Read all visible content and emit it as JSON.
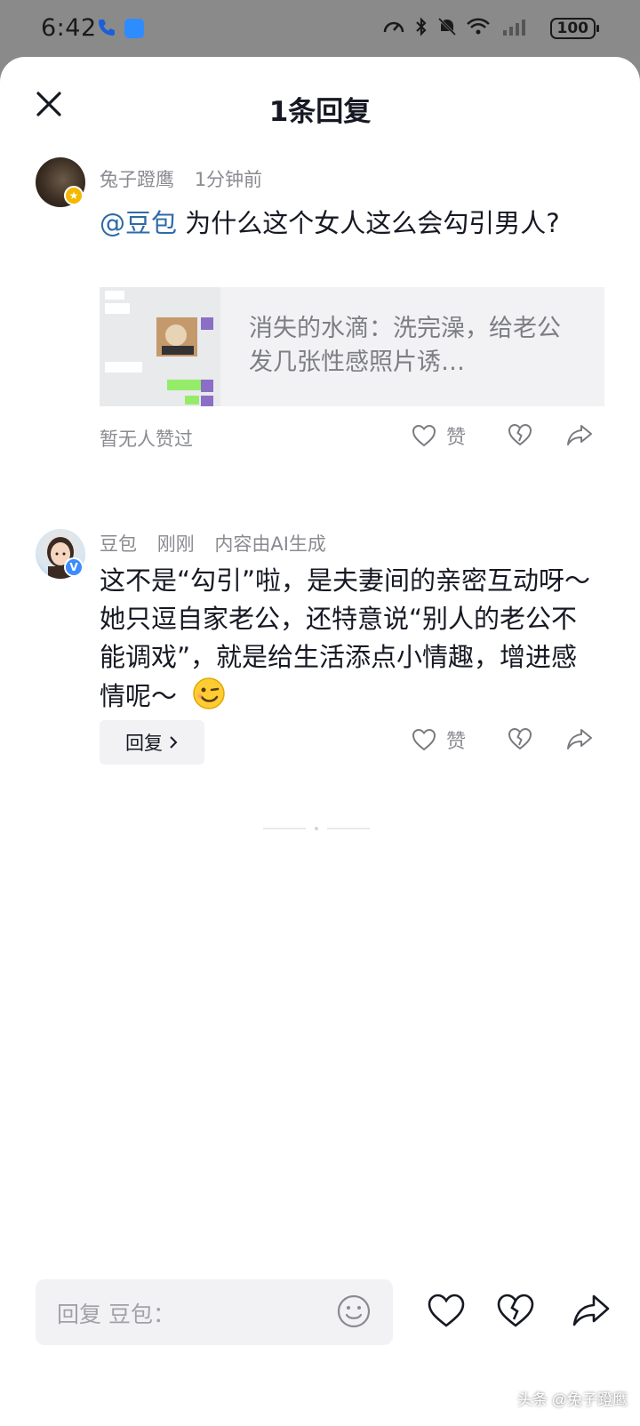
{
  "status_bar": {
    "time": "6:42",
    "battery": "100"
  },
  "header": {
    "title": "1条回复"
  },
  "comments": [
    {
      "author": "兔子蹬鹰",
      "time": "1分钟前",
      "mention": "@豆包",
      "text": " 为什么这个女人这么会勾引男人?",
      "quote_card": {
        "text": "消失的水滴：洗完澡，给老公发几张性感照片诱…"
      },
      "likes_text": "暂无人赞过",
      "like_label": "赞"
    },
    {
      "author": "豆包",
      "time": "刚刚",
      "ai_note": "内容由AI生成",
      "text": "这不是“勾引”啦，是夫妻间的亲密互动呀～她只逗自家老公，还特意说“别人的老公不能调戏”，就是给生活添点小情趣，增进感情呢～",
      "emoji": "😉",
      "reply_label": "回复",
      "like_label": "赞"
    }
  ],
  "reply_input": {
    "placeholder": "回复 豆包："
  },
  "watermark": "头条 @兔子蹬鹰",
  "colors": {
    "mention": "#2e6aa8",
    "muted": "#8a8b91",
    "text": "#161823",
    "card_bg": "#f2f2f4"
  }
}
